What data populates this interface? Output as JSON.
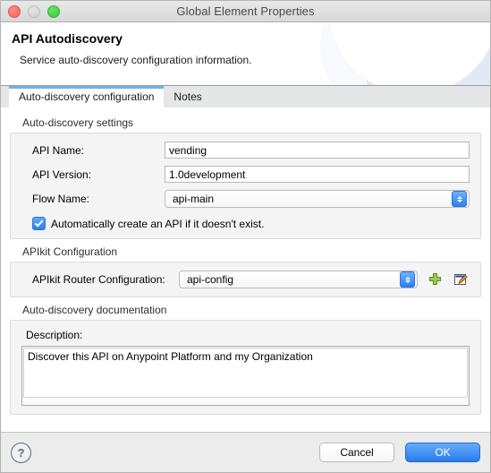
{
  "window": {
    "title": "Global Element Properties",
    "traffic_lights": [
      "close-light",
      "minimize-light",
      "zoom-light"
    ]
  },
  "header": {
    "title": "API Autodiscovery",
    "subtitle": "Service auto-discovery configuration information."
  },
  "tabs": [
    {
      "label": "Auto-discovery configuration",
      "active": true
    },
    {
      "label": "Notes",
      "active": false
    }
  ],
  "settings_group": {
    "title": "Auto-discovery settings",
    "fields": [
      {
        "label": "API Name:",
        "value": "vending",
        "placeholder": "",
        "type": "text"
      },
      {
        "label": "API Version:",
        "value": "1.0development",
        "placeholder": "",
        "type": "text"
      },
      {
        "label": "Flow Name:",
        "value": "api-main",
        "type": "combo"
      }
    ],
    "checkbox": {
      "label": "Automatically create an API if it doesn't exist.",
      "checked": true
    }
  },
  "apikit_group": {
    "title": "APIkit Configuration",
    "field": {
      "label": "APIkit Router Configuration:",
      "value": "api-config"
    },
    "add_icon": "plus-icon",
    "edit_icon": "edit-icon"
  },
  "docs_group": {
    "title": "Auto-discovery documentation",
    "description_label": "Description:",
    "description_value": "Discover this API on Anypoint Platform and my Organization",
    "description_placeholder": ""
  },
  "footer": {
    "help_label": "?",
    "cancel_label": "Cancel",
    "ok_label": "OK"
  },
  "colors": {
    "accent_blue": "#2f7fef",
    "tab_highlight": "#6fb3dc",
    "add_green": "#7cb842"
  }
}
